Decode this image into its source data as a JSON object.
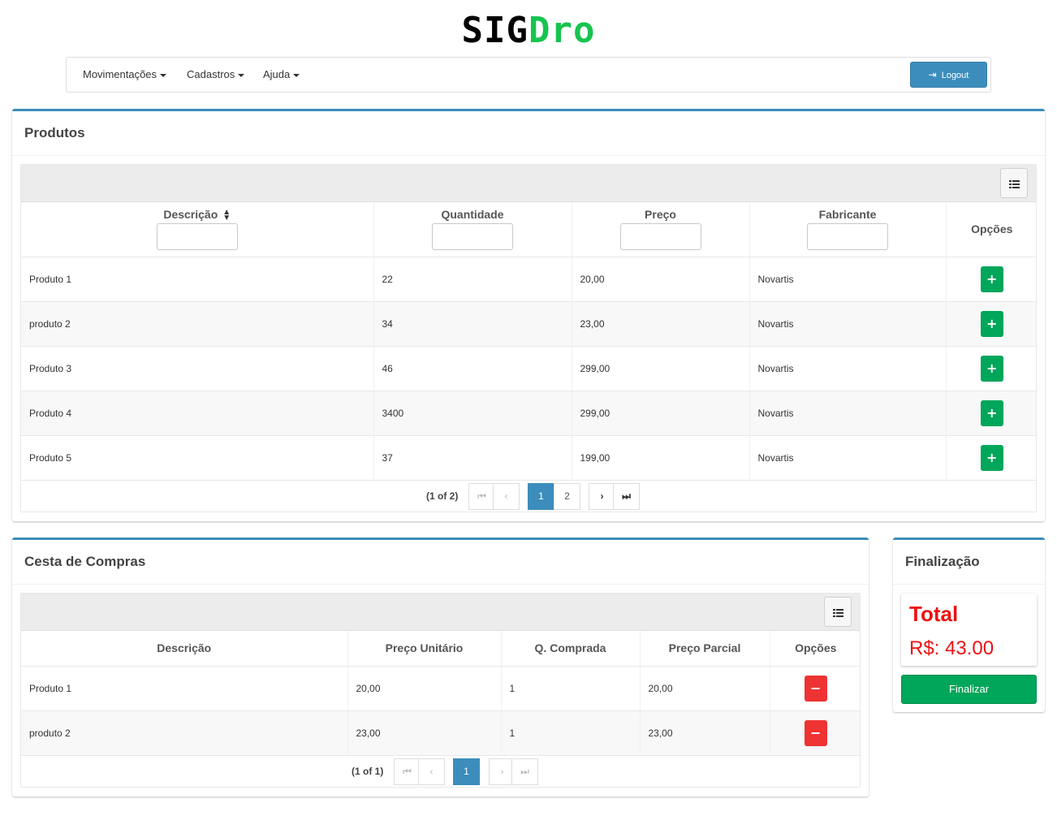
{
  "brand": {
    "part1": "SIG",
    "part2": "Dro"
  },
  "nav": {
    "menus": [
      {
        "label": "Movimentações"
      },
      {
        "label": "Cadastros"
      },
      {
        "label": "Ajuda"
      }
    ],
    "logout_label": "Logout"
  },
  "produtos": {
    "title": "Produtos",
    "columns": [
      "Descrição",
      "Quantidade",
      "Preço",
      "Fabricante",
      "Opções"
    ],
    "rows": [
      {
        "descricao": "Produto 1",
        "quantidade": "22",
        "preco": "20,00",
        "fabricante": "Novartis",
        "action": "+"
      },
      {
        "descricao": "produto 2",
        "quantidade": "34",
        "preco": "23,00",
        "fabricante": "Novartis",
        "action": "+"
      },
      {
        "descricao": "Produto 3",
        "quantidade": "46",
        "preco": "299,00",
        "fabricante": "Novartis",
        "action": "+"
      },
      {
        "descricao": "Produto 4",
        "quantidade": "3400",
        "preco": "299,00",
        "fabricante": "Novartis",
        "action": "+"
      },
      {
        "descricao": "Produto 5",
        "quantidade": "37",
        "preco": "199,00",
        "fabricante": "Novartis",
        "action": "+"
      }
    ],
    "paginator": {
      "current": "(1 of 2)",
      "first": "⏮",
      "prev": "‹",
      "pages": [
        "1",
        "2"
      ],
      "next": "›",
      "last": "⏭"
    }
  },
  "cesta": {
    "title": "Cesta de Compras",
    "columns": [
      "Descrição",
      "Preço Unitário",
      "Q. Comprada",
      "Preço Parcial",
      "Opções"
    ],
    "rows": [
      {
        "descricao": "Produto 1",
        "unitario": "20,00",
        "qtd": "1",
        "parcial": "20,00",
        "action": "−"
      },
      {
        "descricao": "produto 2",
        "unitario": "23,00",
        "qtd": "1",
        "parcial": "23,00",
        "action": "−"
      }
    ],
    "paginator": {
      "current": "(1 of 1)",
      "first": "⏮",
      "prev": "‹",
      "pages": [
        "1"
      ],
      "next": "›",
      "last": "⏭"
    }
  },
  "finalizacao": {
    "title": "Finalização",
    "total_label": "Total",
    "total_value": "R$: 43.00",
    "button_label": "Finalizar"
  },
  "colors": {
    "accent": "#3c8dbc",
    "success": "#00a65a",
    "danger": "#ee3333",
    "brand_green": "#17c44f",
    "total_red": "#ee1111"
  },
  "icons": [
    "sort-icon",
    "column-toggle-icon",
    "plus-icon",
    "minus-icon",
    "sign-out-icon",
    "caret-down-icon"
  ]
}
